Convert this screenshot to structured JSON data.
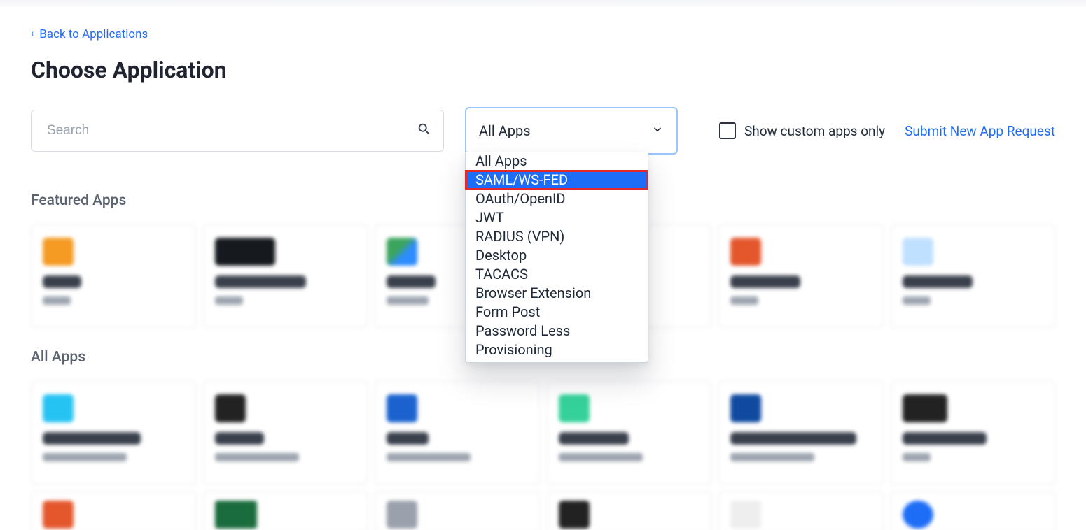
{
  "back_link": "Back to Applications",
  "page_title": "Choose Application",
  "search": {
    "placeholder": "Search"
  },
  "filter": {
    "selected": "All Apps",
    "options": [
      "All Apps",
      "SAML/WS-FED",
      "OAuth/OpenID",
      "JWT",
      "RADIUS (VPN)",
      "Desktop",
      "TACACS",
      "Browser Extension",
      "Form Post",
      "Password Less",
      "Provisioning"
    ],
    "highlighted_index": 1
  },
  "custom_apps_label": "Show custom apps only",
  "submit_request_label": "Submit New App Request",
  "sections": {
    "featured_title": "Featured Apps",
    "all_title": "All Apps"
  }
}
